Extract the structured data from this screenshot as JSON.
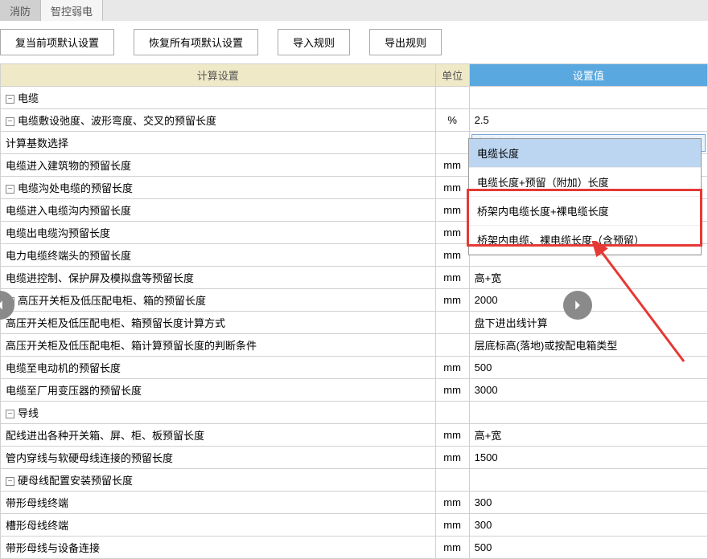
{
  "tabs": {
    "t1": "消防",
    "t2": "智控弱电"
  },
  "buttons": {
    "b1": "复当前项默认设置",
    "b2": "恢复所有项默认设置",
    "b3": "导入规则",
    "b4": "导出规则"
  },
  "headers": {
    "name": "计算设置",
    "unit": "单位",
    "value": "设置值"
  },
  "toggle": "−",
  "unit_pct": "%",
  "unit_mm": "mm",
  "rows": {
    "r0": "电缆",
    "r1": "电缆敷设弛度、波形弯度、交叉的预留长度",
    "v1": "2.5",
    "r2": "计算基数选择",
    "v2": "电缆长度",
    "r3": "电缆进入建筑物的预留长度",
    "r4": "电缆沟处电缆的预留长度",
    "r5": "电缆进入电缆沟内预留长度",
    "r6": "电缆出电缆沟预留长度",
    "r7": "电力电缆终端头的预留长度",
    "r8": "电缆进控制、保护屏及模拟盘等预留长度",
    "v8": "高+宽",
    "r9": "高压开关柜及低压配电柜、箱的预留长度",
    "v9": "2000",
    "r10": "高压开关柜及低压配电柜、箱预留长度计算方式",
    "v10": "盘下进出线计算",
    "r11": "高压开关柜及低压配电柜、箱计算预留长度的判断条件",
    "v11": "层底标高(落地)或按配电箱类型",
    "r12": "电缆至电动机的预留长度",
    "v12": "500",
    "r13": "电缆至厂用变压器的预留长度",
    "v13": "3000",
    "r14": "导线",
    "r15": "配线进出各种开关箱、屏、柜、板预留长度",
    "v15": "高+宽",
    "r16": "管内穿线与软硬母线连接的预留长度",
    "v16": "1500",
    "r17": "硬母线配置安装预留长度",
    "r18": "带形母线终端",
    "v18": "300",
    "r19": "槽形母线终端",
    "v19": "300",
    "r20": "带形母线与设备连接",
    "v20": "500"
  },
  "dropdown": {
    "o1": "电缆长度",
    "o2": "电缆长度+预留（附加）长度",
    "o3": "桥架内电缆长度+裸电缆长度",
    "o4": "桥架内电缆、裸电缆长度（含预留）"
  }
}
